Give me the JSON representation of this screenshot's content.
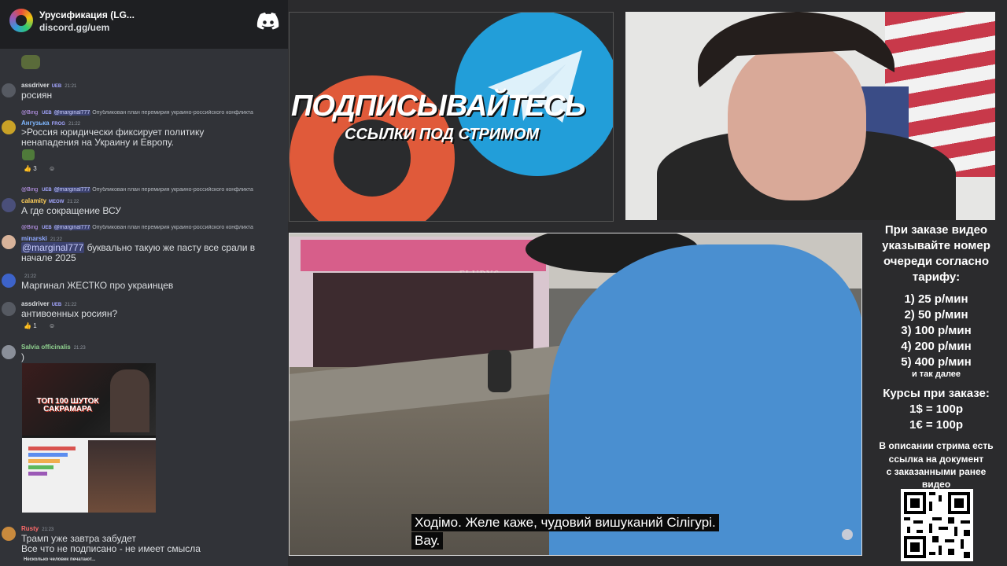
{
  "chat": {
    "server_name": "Урусификация (LG...",
    "server_invite": "discord.gg/uem",
    "messages": [
      {
        "author": "assdriver",
        "badge": "UEB",
        "time": "21:21",
        "text": "росиян"
      },
      {
        "reply_author": "@Bing",
        "reply_badge": "UEB",
        "reply_mention": "@marginal777",
        "reply_text": "Опубликован план перемирия украино-российского конфликта",
        "author": "Ангузька",
        "badge": "FROG",
        "time": "21:22",
        "text_lines": [
          ">Россия юридически фиксирует политику",
          "ненападения на Украину и Европу."
        ],
        "reaction_count": "3"
      },
      {
        "reply_author": "@Bing",
        "reply_badge": "UEB",
        "reply_mention": "@marginal777",
        "reply_text": "Опубликован план перемирия украино-российского конфликта",
        "author": "calamity",
        "badge": "MEOW",
        "time": "21:22",
        "text": "А где сокращение ВСУ"
      },
      {
        "reply_author": "@Bing",
        "reply_badge": "UEB",
        "reply_mention": "@marginal777",
        "reply_text": "Опубликован план перемирия украино-российского конфликта",
        "author": "minarski",
        "badge": "",
        "time": "21:22",
        "mention": "@marginal777",
        "text_lines": [
          " буквально такую же пасту все срали в",
          "начале 2025"
        ]
      },
      {
        "author": "",
        "badge": "",
        "time": "21:22",
        "text": "Маргинал ЖЕСТКО про украинцев"
      },
      {
        "author": "assdriver",
        "badge": "UEB",
        "time": "21:22",
        "text": "антивоенных росиян?",
        "reaction_count": "1"
      },
      {
        "author": "Salvia officinalis",
        "badge": "",
        "time": "21:23",
        "text": ")",
        "embed_title": "ТОП 100 ШУТОК САКРАМАРА"
      },
      {
        "author": "Rusty",
        "badge": "",
        "time": "21:23",
        "text_lines": [
          "Трамп уже завтра забудет",
          "Все что не подписано - не имеет смысла"
        ]
      }
    ],
    "typing": "Несколько человек печатают..."
  },
  "promo": {
    "title": "ПОДПИСЫВАЙТЕСЬ",
    "subtitle": "ССЫЛКИ ПОД СТРИМОМ"
  },
  "video": {
    "store_sign": "FLURYS",
    "subtitle_line1": "Ходімо.  Желе каже, чудовий вишуканий Сілігурі.",
    "subtitle_line2": "Вау."
  },
  "info": {
    "order_lines": [
      "При заказе видео",
      "указывайте номер",
      "очереди согласно",
      "тарифу:"
    ],
    "tariffs": [
      "1) 25 р/мин",
      "2) 50 р/мин",
      "3) 100 р/мин",
      "4) 200 р/мин",
      "5) 400 р/мин"
    ],
    "tariffs_more": "и так далее",
    "rates_title": "Курсы при заказе:",
    "rates": [
      "1$ = 100р",
      "1€ = 100р"
    ],
    "doc_lines": [
      "В описании стрима есть",
      "ссылка на документ",
      "с заказанными ранее",
      "видео"
    ]
  },
  "colors": {
    "discord_bg": "#313338",
    "discord_header": "#1e1f22",
    "page_bg": "#2b2b2d",
    "telegram_blue": "#229ed9",
    "rutube_red": "#e05a3a",
    "shirt_blue": "#4a8fd0"
  },
  "icons": [
    "discord-icon",
    "telegram-plane-icon",
    "qr-code"
  ]
}
